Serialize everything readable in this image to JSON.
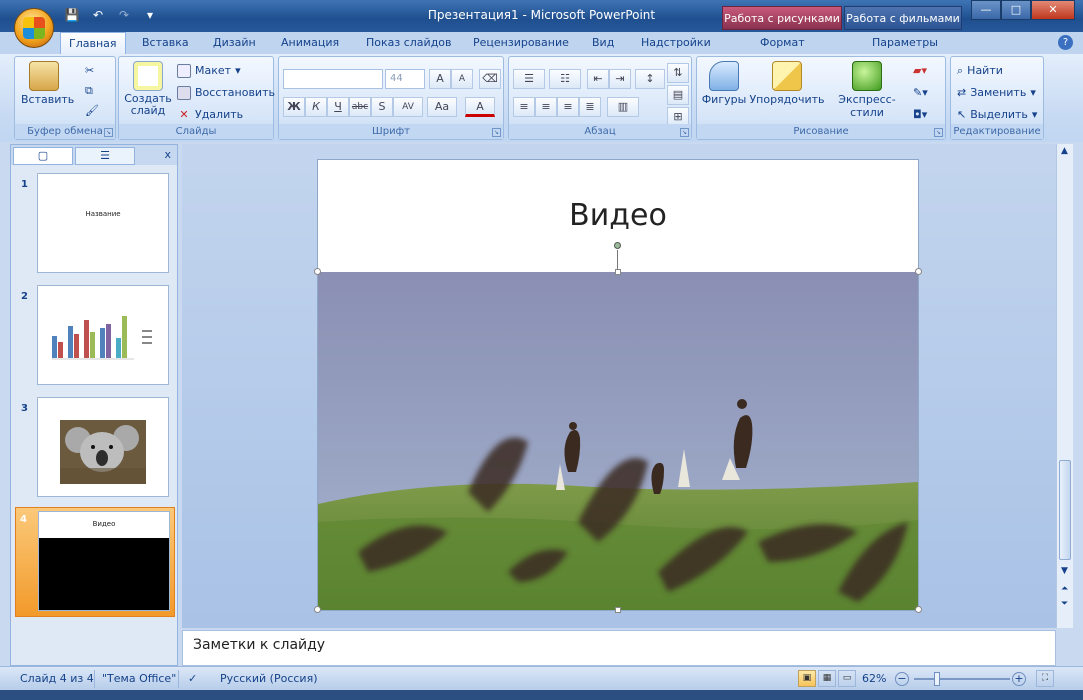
{
  "window": {
    "title": "Презентация1 - Microsoft PowerPoint",
    "context_tab_pictures": "Работа с рисунками",
    "context_tab_movies": "Работа с фильмами",
    "minimize": "—",
    "maximize": "□",
    "close": "✕"
  },
  "qat": {
    "save": "💾",
    "undo": "↶",
    "redo": "↷",
    "customize": "▾"
  },
  "tabs": [
    "Главная",
    "Вставка",
    "Дизайн",
    "Анимация",
    "Показ слайдов",
    "Рецензирование",
    "Вид",
    "Надстройки",
    "Формат",
    "Параметры"
  ],
  "help": "?",
  "ribbon": {
    "clipboard": {
      "label": "Буфер обмена",
      "paste": "Вставить"
    },
    "slides": {
      "label": "Слайды",
      "new_slide": "Создать слайд",
      "layout": "Макет",
      "reset": "Восстановить",
      "delete": "Удалить"
    },
    "font": {
      "label": "Шрифт",
      "font_name": "",
      "font_size": "44",
      "bold": "Ж",
      "italic": "К",
      "underline": "Ч",
      "strike": "abc",
      "shadow": "S",
      "spacing": "AV",
      "case": "Aa",
      "color": "A",
      "grow": "A",
      "shrink": "A"
    },
    "paragraph": {
      "label": "Абзац"
    },
    "drawing": {
      "label": "Рисование",
      "shapes": "Фигуры",
      "arrange": "Упорядочить",
      "quick_styles": "Экспресс-стили"
    },
    "editing": {
      "label": "Редактирование",
      "find": "Найти",
      "replace": "Заменить",
      "select": "Выделить"
    }
  },
  "panel": {
    "close": "x",
    "thumbs": [
      {
        "num": "1",
        "text": "Название"
      },
      {
        "num": "2",
        "text": ""
      },
      {
        "num": "3",
        "text": ""
      },
      {
        "num": "4",
        "text": "Видео"
      }
    ]
  },
  "slide": {
    "title": "Видео"
  },
  "notes": {
    "placeholder": "Заметки к слайду"
  },
  "status": {
    "slide_count": "Слайд 4 из 4",
    "theme": "\"Тема Office\"",
    "language": "Русский (Россия)",
    "zoom": "62%",
    "zoom_minus": "−",
    "zoom_plus": "+"
  },
  "colors": {
    "accent": "#15428b",
    "selection": "#f29a2a",
    "ribbon": "#c7daf3"
  }
}
